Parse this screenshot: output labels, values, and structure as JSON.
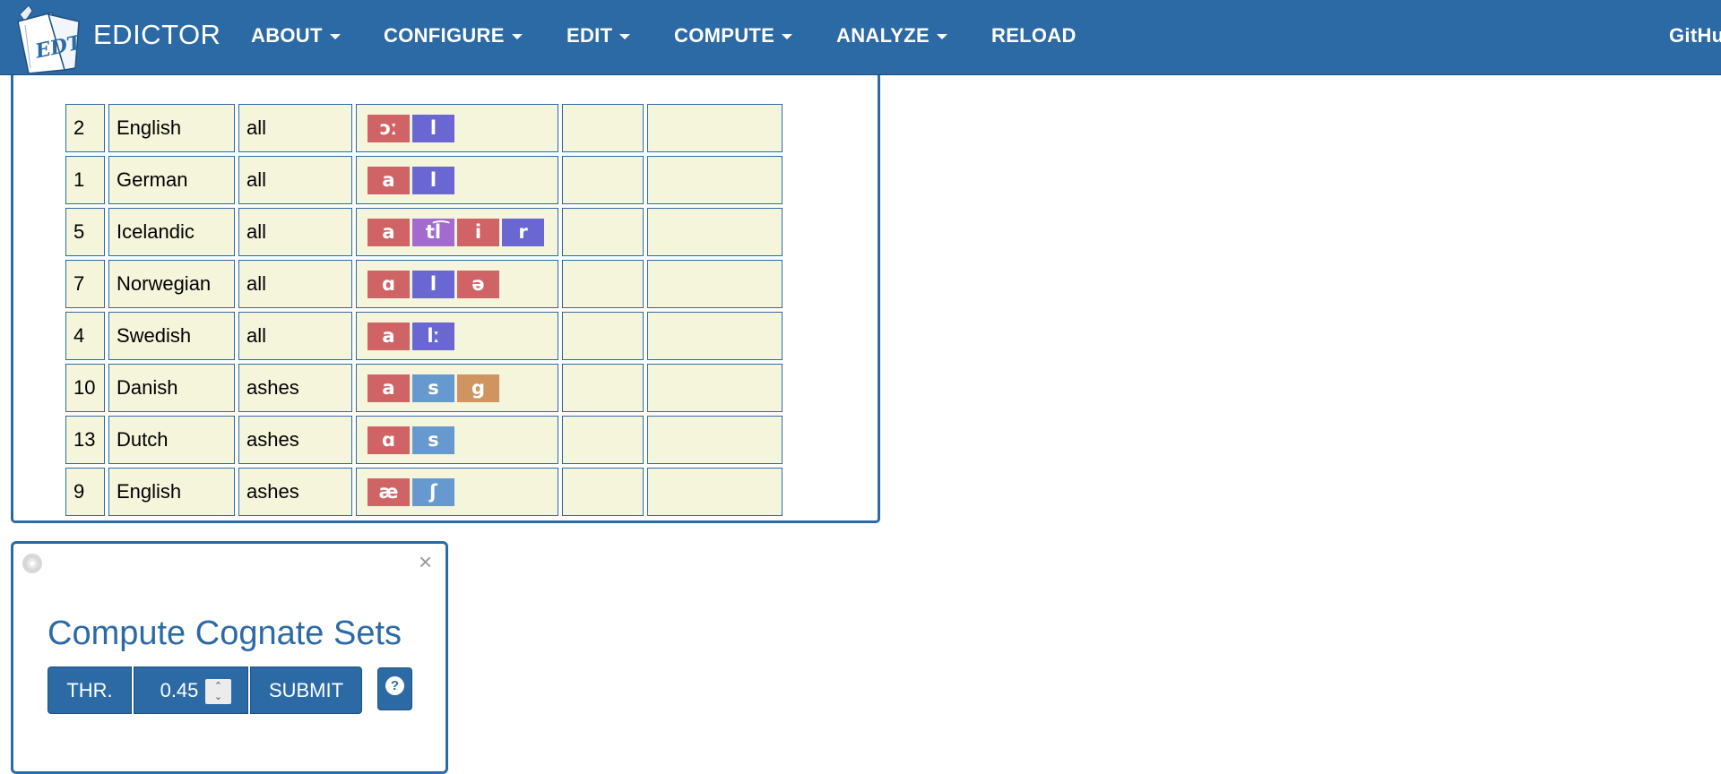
{
  "navbar": {
    "brand": "EDICTOR",
    "logo_letters": "EDT",
    "items": [
      {
        "label": "ABOUT",
        "dropdown": true
      },
      {
        "label": "CONFIGURE",
        "dropdown": true
      },
      {
        "label": "EDIT",
        "dropdown": true
      },
      {
        "label": "COMPUTE",
        "dropdown": true
      },
      {
        "label": "ANALYZE",
        "dropdown": true
      },
      {
        "label": "RELOAD",
        "dropdown": false
      }
    ],
    "right_link": "GitHu"
  },
  "colors": {
    "navbar_bg": "#2c6aa6",
    "cell_bg": "#f5f5dc",
    "vowel": "#d06366",
    "liquid": "#6a67d2",
    "affricate": "#a36ad0",
    "fricative": "#6599cf",
    "stop": "#d09460"
  },
  "wordlist": {
    "rows": [
      {
        "id": "2",
        "doculect": "English",
        "concept": "all",
        "tokens": [
          {
            "t": "ɔː",
            "c": "vowel"
          },
          {
            "t": "l",
            "c": "liquid"
          }
        ]
      },
      {
        "id": "1",
        "doculect": "German",
        "concept": "all",
        "tokens": [
          {
            "t": "a",
            "c": "vowel"
          },
          {
            "t": "l",
            "c": "liquid"
          }
        ]
      },
      {
        "id": "5",
        "doculect": "Icelandic",
        "concept": "all",
        "tokens": [
          {
            "t": "a",
            "c": "vowel"
          },
          {
            "t": "tl͡",
            "c": "affricate"
          },
          {
            "t": "i",
            "c": "vowel"
          },
          {
            "t": "r",
            "c": "liquid"
          }
        ]
      },
      {
        "id": "7",
        "doculect": "Norwegian",
        "concept": "all",
        "tokens": [
          {
            "t": "ɑ",
            "c": "vowel"
          },
          {
            "t": "l",
            "c": "liquid"
          },
          {
            "t": "ə",
            "c": "vowel"
          }
        ]
      },
      {
        "id": "4",
        "doculect": "Swedish",
        "concept": "all",
        "tokens": [
          {
            "t": "a",
            "c": "vowel"
          },
          {
            "t": "lː",
            "c": "liquid"
          }
        ]
      },
      {
        "id": "10",
        "doculect": "Danish",
        "concept": "ashes",
        "tokens": [
          {
            "t": "a",
            "c": "vowel"
          },
          {
            "t": "s",
            "c": "fricative"
          },
          {
            "t": "g",
            "c": "stop"
          }
        ]
      },
      {
        "id": "13",
        "doculect": "Dutch",
        "concept": "ashes",
        "tokens": [
          {
            "t": "ɑ",
            "c": "vowel"
          },
          {
            "t": "s",
            "c": "fricative"
          }
        ]
      },
      {
        "id": "9",
        "doculect": "English",
        "concept": "ashes",
        "tokens": [
          {
            "t": "æ",
            "c": "vowel"
          },
          {
            "t": "ʃ",
            "c": "fricative"
          }
        ]
      }
    ]
  },
  "compute_panel": {
    "title": "Compute Cognate Sets",
    "thr_label": "THR.",
    "threshold": "0.45",
    "submit_label": "SUBMIT",
    "help_label": "?",
    "close_label": "×"
  }
}
